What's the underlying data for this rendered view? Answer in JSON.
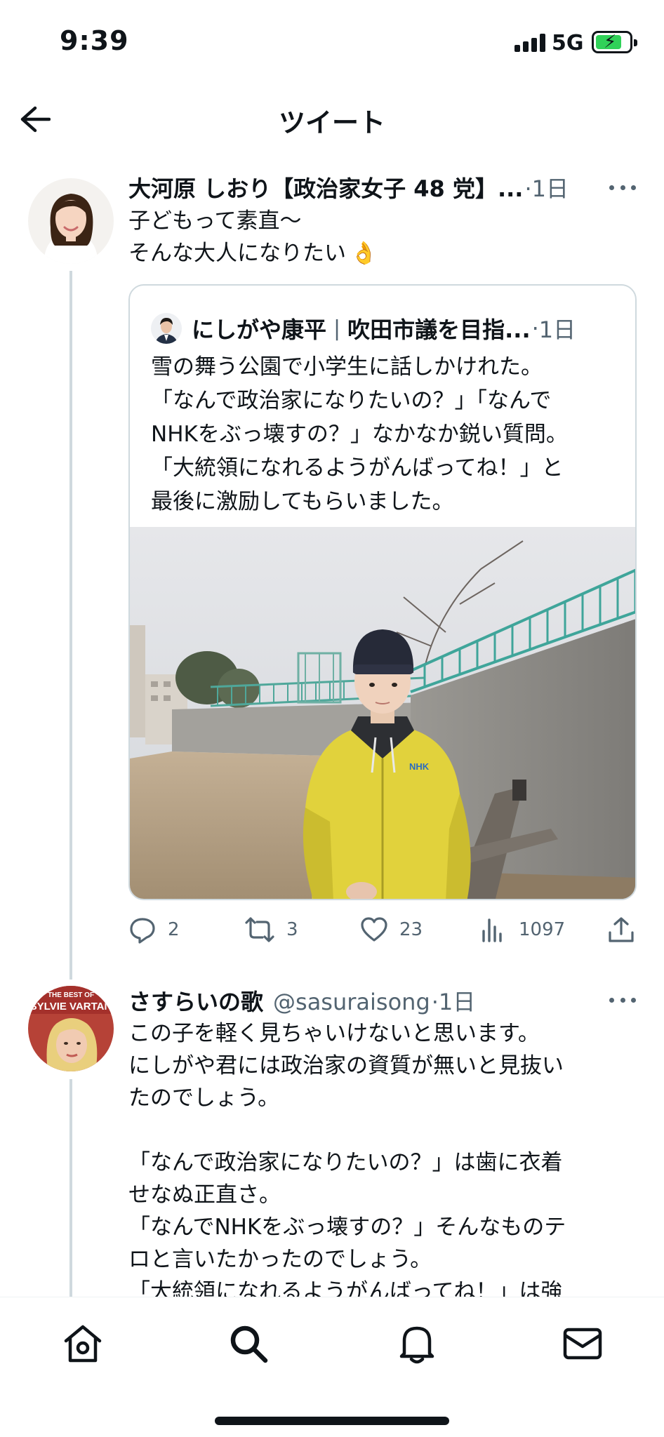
{
  "status_bar": {
    "time": "9:39",
    "network": "5G"
  },
  "header": {
    "title": "ツイート"
  },
  "main_tweet": {
    "name": "大河原 しおり【政治家女子 48 党】...",
    "dot": "·",
    "time": "1日",
    "text": "子どもって素直〜\nそんな大人になりたい",
    "emoji": "👌",
    "quote": {
      "name": "にしがや康平",
      "separator": "|",
      "bio": "吹田市議を目指...",
      "dot": "·",
      "time": "1日",
      "text": "雪の舞う公園で小学生に話しかけれた。\n「なんで政治家になりたいの？」「なんで\nNHKをぶっ壊すの？」なかなか鋭い質問。\n「大統領になれるようがんばってね！」と\n最後に激励してもらいました。",
      "image_jacket_text": "NHK"
    },
    "actions": {
      "reply_count": "2",
      "retweet_count": "3",
      "like_count": "23",
      "view_count": "1097"
    }
  },
  "reply_tweet": {
    "name": "さすらいの歌",
    "handle": "@sasuraisong",
    "dot": "·",
    "time": "1日",
    "avatar_text_1": "THE BEST OF",
    "avatar_text_2": "SYLVIE VARTAN",
    "text": "この子を軽く見ちゃいけないと思います。\nにしがや君には政治家の資質が無いと見抜い\nたのでしょう。\n\n「なんで政治家になりたいの？」は歯に衣着\nせなぬ正直さ。\n「なんでNHKをぶっ壊すの？」そんなものテ\nロと言いたかったのでしょう。\n「大統領になれるようがんばってね！」は強"
  },
  "icons": {
    "back": "arrow-left-icon",
    "more": "more-dots-icon",
    "reply": "comment-icon",
    "retweet": "retweet-icon",
    "like": "heart-icon",
    "views": "analytics-icon",
    "share": "share-icon",
    "home": "home-icon",
    "search": "search-icon",
    "notifications": "bell-icon",
    "messages": "mail-icon"
  },
  "colors": {
    "text_primary": "#0f1419",
    "text_secondary": "#536471",
    "border": "#cfd9de",
    "battery_green": "#30d158"
  }
}
